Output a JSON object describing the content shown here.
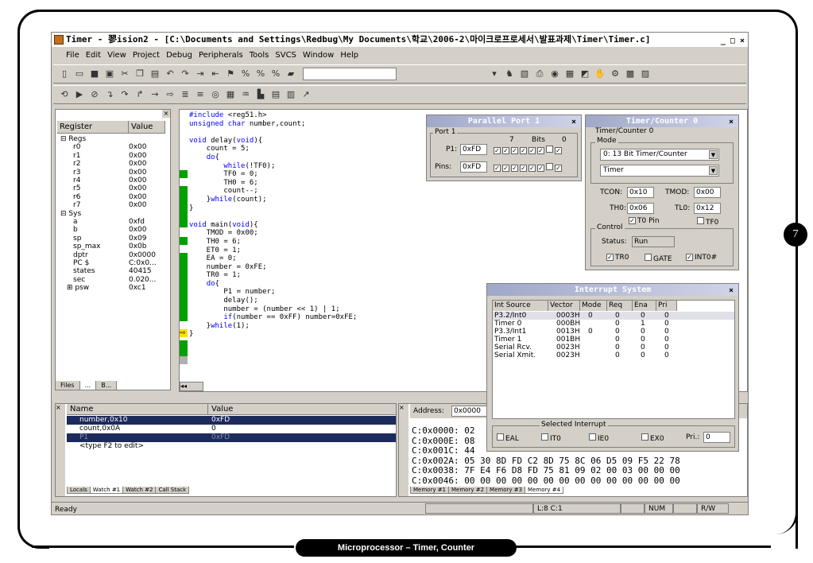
{
  "window": {
    "title": "Timer - 翏ision2 - [C:\\Documents and Settings\\Redbug\\My Documents\\학교\\2006-2\\마이크로프로세서\\발표과제\\Timer\\Timer.c]",
    "controls": "_ □ ×"
  },
  "menu": [
    "File",
    "Edit",
    "View",
    "Project",
    "Debug",
    "Peripherals",
    "Tools",
    "SVCS",
    "Window",
    "Help"
  ],
  "registers": {
    "headers": [
      "Register",
      "Value"
    ],
    "rows": [
      {
        "name": "⊟ Regs",
        "value": "",
        "indent": 0
      },
      {
        "name": "r0",
        "value": "0x00",
        "indent": 2
      },
      {
        "name": "r1",
        "value": "0x00",
        "indent": 2
      },
      {
        "name": "r2",
        "value": "0x00",
        "indent": 2
      },
      {
        "name": "r3",
        "value": "0x00",
        "indent": 2
      },
      {
        "name": "r4",
        "value": "0x00",
        "indent": 2
      },
      {
        "name": "r5",
        "value": "0x00",
        "indent": 2
      },
      {
        "name": "r6",
        "value": "0x00",
        "indent": 2
      },
      {
        "name": "r7",
        "value": "0x00",
        "indent": 2
      },
      {
        "name": "⊟ Sys",
        "value": "",
        "indent": 0
      },
      {
        "name": "a",
        "value": "0xfd",
        "indent": 2
      },
      {
        "name": "b",
        "value": "0x00",
        "indent": 2
      },
      {
        "name": "sp",
        "value": "0x09",
        "indent": 2
      },
      {
        "name": "sp_max",
        "value": "0x0b",
        "indent": 2
      },
      {
        "name": "dptr",
        "value": "0x0000",
        "indent": 2
      },
      {
        "name": "PC  $",
        "value": "C:0x0...",
        "indent": 2
      },
      {
        "name": "states",
        "value": "40415",
        "indent": 2
      },
      {
        "name": "sec",
        "value": "0.020...",
        "indent": 2
      },
      {
        "name": "⊞ psw",
        "value": "0xc1",
        "indent": 1
      }
    ],
    "tabs": [
      "Files",
      "...",
      "B..."
    ]
  },
  "code": [
    "#include <reg51.h>",
    "unsigned char number,count;",
    "",
    "void delay(void){",
    "    count = 5;",
    "    do{",
    "        while(!TF0);",
    "        TF0 = 0;",
    "        TH0 = 6;",
    "        count--;",
    "    }while(count);",
    "}",
    "",
    "void main(void){",
    "    TMOD = 0x00;",
    "    TH0 = 6;",
    "    ET0 = 1;",
    "    EA = 0;",
    "    number = 0xFE;",
    "    TR0 = 1;",
    "    do{",
    "        P1 = number;",
    "        delay();",
    "        number = (number << 1) | 1;",
    "        if(number == 0xFF) number=0xFE;",
    "    }while(1);",
    "}"
  ],
  "parallel_port": {
    "title": "Parallel Port 1",
    "group": "Port 1",
    "p1_label": "P1:",
    "p1_value": "0xFD",
    "pins_label": "Pins:",
    "pins_value": "0xFD",
    "bit_hi": "7",
    "bits_label": "Bits",
    "bit_lo": "0"
  },
  "timer": {
    "title": "Timer/Counter 0",
    "group": "Timer/Counter 0",
    "mode_group": "Mode",
    "mode_value": "0: 13 Bit Timer/Counter",
    "type_value": "Timer",
    "tcon_label": "TCON:",
    "tcon_value": "0x10",
    "tmod_label": "TMOD:",
    "tmod_value": "0x00",
    "th0_label": "TH0:",
    "th0_value": "0x06",
    "tl0_label": "TL0:",
    "tl0_value": "0x12",
    "control_group": "Control",
    "t0pin_label": "T0 Pin",
    "tf0_label": "TF0",
    "status_label": "Status:",
    "status_value": "Run",
    "tr0_label": "TR0",
    "gate_label": "GATE",
    "int0_label": "INT0#"
  },
  "interrupt": {
    "title": "Interrupt System",
    "headers": [
      "Int Source",
      "Vector",
      "Mode",
      "Req",
      "Ena",
      "Pri"
    ],
    "rows": [
      [
        "P3.2/Int0",
        "0003H",
        "0",
        "0",
        "0",
        "0"
      ],
      [
        "Timer 0",
        "000BH",
        "",
        "0",
        "1",
        "0"
      ],
      [
        "P3.3/Int1",
        "0013H",
        "0",
        "0",
        "0",
        "0"
      ],
      [
        "Timer 1",
        "001BH",
        "",
        "0",
        "0",
        "0"
      ],
      [
        "Serial Rcv.",
        "0023H",
        "",
        "0",
        "0",
        "0"
      ],
      [
        "Serial Xmit.",
        "0023H",
        "",
        "0",
        "0",
        "0"
      ]
    ],
    "selected_group": "Selected Interrupt",
    "eal": "EAL",
    "it0": "IT0",
    "ie0": "IE0",
    "ex0": "EX0",
    "pri_label": "Pri.:",
    "pri_value": "0"
  },
  "watch": {
    "headers": [
      "Name",
      "Value"
    ],
    "rows": [
      [
        "number,0x10",
        "0xFD"
      ],
      [
        "count,0x0A",
        "0"
      ],
      [
        "P1",
        "0xFD"
      ],
      [
        "<type F2 to edit>",
        ""
      ]
    ],
    "tabs": [
      "Locals",
      "Watch #1",
      "Watch #2",
      "Call Stack"
    ]
  },
  "memory": {
    "address_label": "Address:",
    "address_value": "0x0000",
    "lines": [
      "C:0x0000: 02",
      "C:0x000E: 08",
      "C:0x001C: 44",
      "C:0x002A: 05 30 8D FD C2 8D 75 8C 06 D5 09 F5 22 78",
      "C:0x0038: 7F E4 F6 D8 FD 75 81 09 02 00 03 00 00 00",
      "C:0x0046: 00 00 00 00 00 00 00 00 00 00 00 00 00 00"
    ],
    "tabs": [
      "Memory #1",
      "Memory #2",
      "Memory #3",
      "Memory #4"
    ]
  },
  "status": {
    "ready": "Ready",
    "position": "L:8 C:1",
    "num": "NUM",
    "rw": "R/W"
  },
  "caption": "Microprocessor – Timer, Counter",
  "page_number": "7"
}
